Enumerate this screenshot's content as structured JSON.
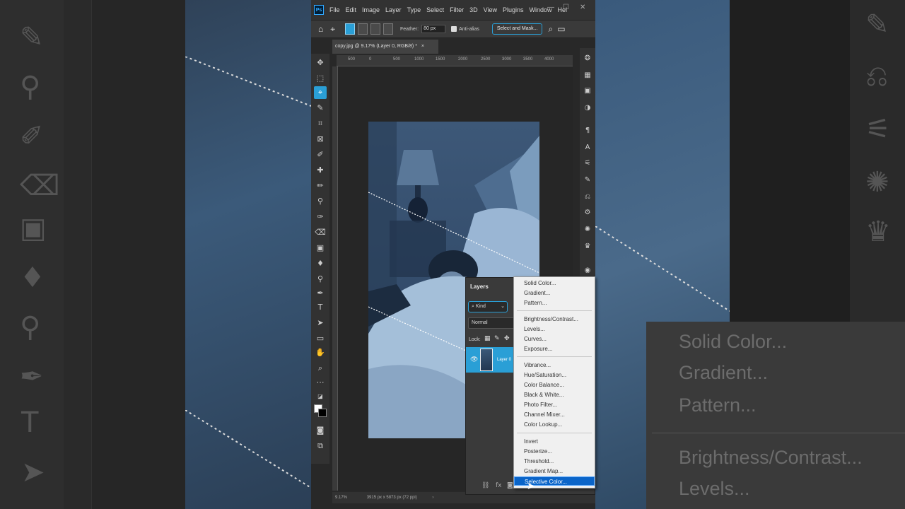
{
  "app": {
    "menu": [
      "File",
      "Edit",
      "Image",
      "Layer",
      "Type",
      "Select",
      "Filter",
      "3D",
      "View",
      "Plugins",
      "Window",
      "Hel"
    ],
    "logo": "Ps",
    "window_controls": [
      "—",
      "☐",
      "✕"
    ]
  },
  "options_bar": {
    "feather_label": "Feather:",
    "feather_value": "80 px",
    "anti_alias_label": "Anti-alias",
    "select_and_mask_label": "Select and Mask..."
  },
  "document": {
    "tab_title": "copy.jpg @ 9.17% (Layer 0, RGB/8) *",
    "tab_close": "×",
    "ruler_ticks": [
      "500",
      "0",
      "500",
      "1000",
      "1500",
      "2000",
      "2500",
      "3000",
      "3500",
      "4000"
    ],
    "zoom": "9.17%",
    "size_info": "3915 px x 5873 px (72 ppi)"
  },
  "layers_panel": {
    "title": "Layers",
    "kind_label": "Kind",
    "blend_mode": "Normal",
    "lock_label": "Lock:",
    "layer_name": "Layer 0"
  },
  "adjustment_menu": {
    "groups": [
      [
        "Solid Color...",
        "Gradient...",
        "Pattern..."
      ],
      [
        "Brightness/Contrast...",
        "Levels...",
        "Curves...",
        "Exposure..."
      ],
      [
        "Vibrance...",
        "Hue/Saturation...",
        "Color Balance...",
        "Black & White...",
        "Photo Filter...",
        "Channel Mixer...",
        "Color Lookup..."
      ],
      [
        "Invert",
        "Posterize...",
        "Threshold...",
        "Gradient Map...",
        "Selective Color..."
      ]
    ],
    "highlighted": "Selective Color..."
  },
  "background_zoom_menu": [
    "Solid Color...",
    "Gradient...",
    "Pattern...",
    "Brightness/Contrast...",
    "Levels..."
  ],
  "colors": {
    "accent": "#2a9fd6",
    "menu_highlight": "#0a64c8"
  },
  "icons": {
    "tools": [
      "move-icon",
      "marquee-icon",
      "polygonal-lasso-icon",
      "quick-selection-icon",
      "crop-icon",
      "frame-icon",
      "eyedropper-icon",
      "healing-brush-icon",
      "brush-icon",
      "clone-stamp-icon",
      "history-brush-icon",
      "eraser-icon",
      "gradient-icon",
      "blur-icon",
      "dodge-icon",
      "pen-icon",
      "type-icon",
      "path-selection-icon",
      "rectangle-icon",
      "hand-icon",
      "zoom-icon",
      "more-tools-icon"
    ]
  }
}
